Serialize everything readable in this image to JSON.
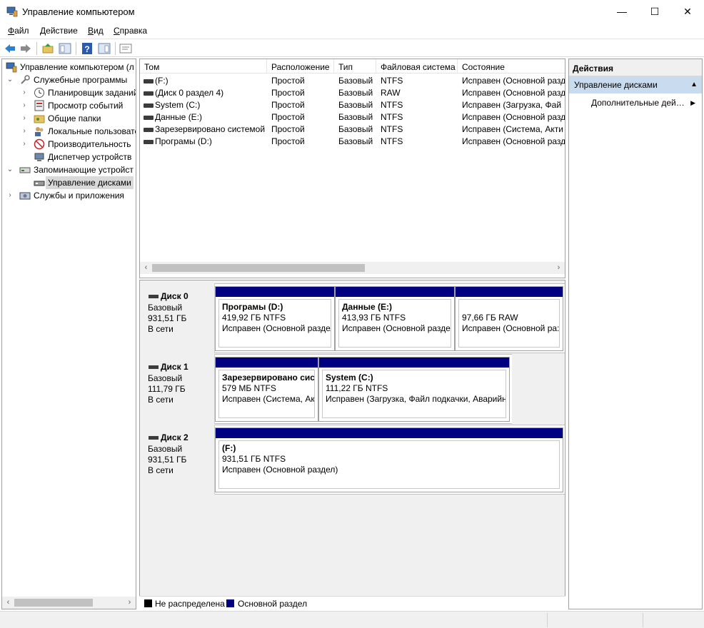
{
  "window": {
    "title": "Управление компьютером",
    "minimize": "—",
    "maximize": "☐",
    "close": "✕"
  },
  "menu": [
    {
      "label": "Файл",
      "accel": "Ф",
      "rest": "айл"
    },
    {
      "label": "Действие",
      "accel": "Д",
      "rest": "ействие"
    },
    {
      "label": "Вид",
      "accel": "В",
      "rest": "ид"
    },
    {
      "label": "Справка",
      "accel": "С",
      "rest": "правка"
    }
  ],
  "tree": {
    "root": "Управление компьютером (л",
    "items": [
      {
        "label": "Служебные программы",
        "icon": "tools-icon"
      },
      {
        "label": "Планировщик заданий",
        "icon": "clock-icon"
      },
      {
        "label": "Просмотр событий",
        "icon": "event-viewer-icon"
      },
      {
        "label": "Общие папки",
        "icon": "shared-folder-icon"
      },
      {
        "label": "Локальные пользовате",
        "icon": "users-icon"
      },
      {
        "label": "Производительность",
        "icon": "performance-icon"
      },
      {
        "label": "Диспетчер устройств",
        "icon": "device-manager-icon"
      },
      {
        "label": "Запоминающие устройст",
        "icon": "storage-icon"
      },
      {
        "label": "Управление дисками",
        "icon": "disk-management-icon"
      },
      {
        "label": "Службы и приложения",
        "icon": "services-icon"
      }
    ]
  },
  "volume_table": {
    "columns": [
      "Том",
      "Расположение",
      "Тип",
      "Файловая система",
      "Состояние"
    ],
    "rows": [
      {
        "vol": " (F:)",
        "layout": "Простой",
        "type": "Базовый",
        "fs": "NTFS",
        "status": "Исправен (Основной разд"
      },
      {
        "vol": "(Диск 0 раздел 4)",
        "layout": "Простой",
        "type": "Базовый",
        "fs": "RAW",
        "status": "Исправен (Основной разд"
      },
      {
        "vol": "System (C:)",
        "layout": "Простой",
        "type": "Базовый",
        "fs": "NTFS",
        "status": "Исправен (Загрузка, Фай"
      },
      {
        "vol": "Данные (E:)",
        "layout": "Простой",
        "type": "Базовый",
        "fs": "NTFS",
        "status": "Исправен (Основной разд"
      },
      {
        "vol": "Зарезервировано системой",
        "layout": "Простой",
        "type": "Базовый",
        "fs": "NTFS",
        "status": "Исправен (Система, Акти"
      },
      {
        "vol": "Програмы (D:)",
        "layout": "Простой",
        "type": "Базовый",
        "fs": "NTFS",
        "status": "Исправен (Основной разд"
      }
    ]
  },
  "disks": [
    {
      "name": "Диск 0",
      "type": "Базовый",
      "size": "931,51 ГБ",
      "state": "В сети",
      "partitions": [
        {
          "name": "Програмы  (D:)",
          "size": "419,92 ГБ NTFS",
          "status": "Исправен (Основной раздел"
        },
        {
          "name": "Данные  (E:)",
          "size": "413,93 ГБ NTFS",
          "status": "Исправен (Основной разде."
        },
        {
          "name": "",
          "size": "97,66 ГБ RAW",
          "status": "Исправен (Основной ра:"
        }
      ]
    },
    {
      "name": "Диск 1",
      "type": "Базовый",
      "size": "111,79 ГБ",
      "state": "В сети",
      "partitions": [
        {
          "name": "Зарезервировано сист",
          "size": "579 МБ NTFS",
          "status": "Исправен (Система, Акт"
        },
        {
          "name": "System  (C:)",
          "size": "111,22 ГБ NTFS",
          "status": "Исправен (Загрузка, Файл подкачки, Аварийн"
        }
      ]
    },
    {
      "name": "Диск 2",
      "type": "Базовый",
      "size": "931,51 ГБ",
      "state": "В сети",
      "partitions": [
        {
          "name": "  (F:)",
          "size": "931,51 ГБ NTFS",
          "status": "Исправен (Основной раздел)"
        }
      ]
    }
  ],
  "legend": [
    {
      "label": "Не распределена",
      "color": "#000000"
    },
    {
      "label": "Основной раздел",
      "color": "#000080"
    }
  ],
  "actions": {
    "header": "Действия",
    "section": "Управление дисками",
    "item": "Дополнительные дей…"
  },
  "colors": {
    "primary_partition": "#000080",
    "unallocated": "#000000",
    "selection": "#d9d9d9",
    "actions_section": "#c9dbee"
  }
}
